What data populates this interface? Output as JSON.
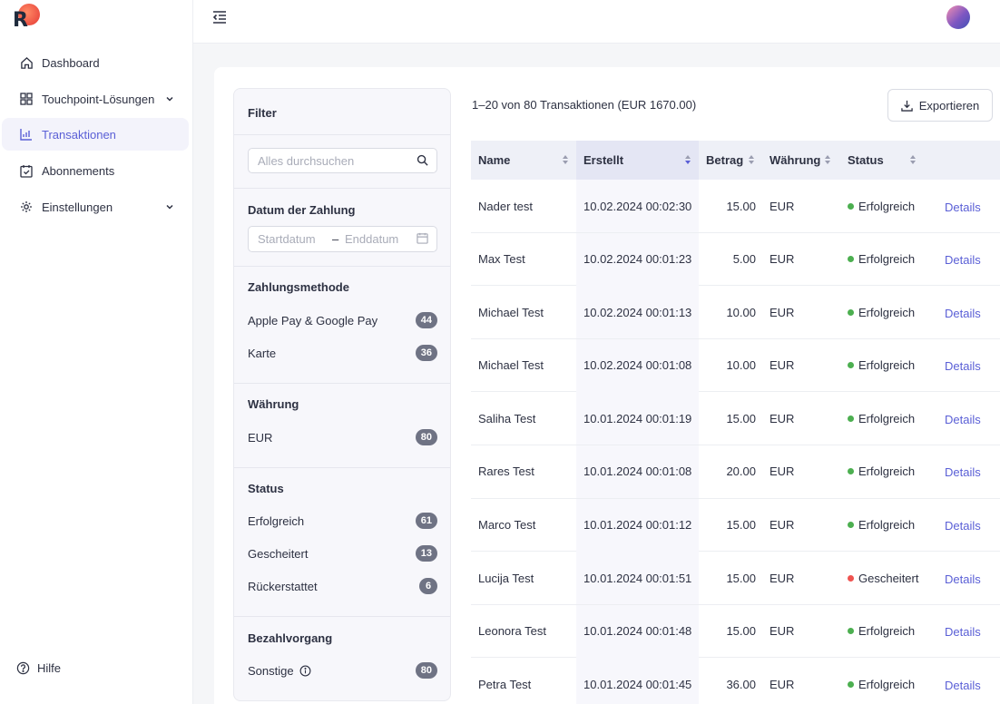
{
  "sidebar": {
    "logo_letter": "R",
    "items": [
      {
        "label": "Dashboard",
        "icon": "home-icon"
      },
      {
        "label": "Touchpoint-Lösungen",
        "icon": "grid-icon"
      },
      {
        "label": "Transaktionen",
        "icon": "bar-chart-icon"
      },
      {
        "label": "Abonnements",
        "icon": "calendar-check-icon"
      },
      {
        "label": "Einstellungen",
        "icon": "gear-icon"
      }
    ],
    "help_label": "Hilfe"
  },
  "filter": {
    "title": "Filter",
    "search_placeholder": "Alles durchsuchen",
    "date_heading": "Datum der Zahlung",
    "date_start_placeholder": "Startdatum",
    "date_separator": "–",
    "date_end_placeholder": "Enddatum",
    "payment_heading": "Zahlungsmethode",
    "payment_options": [
      {
        "label": "Apple Pay & Google Pay",
        "count": "44"
      },
      {
        "label": "Karte",
        "count": "36"
      }
    ],
    "currency_heading": "Währung",
    "currency_options": [
      {
        "label": "EUR",
        "count": "80"
      }
    ],
    "status_heading": "Status",
    "status_options": [
      {
        "label": "Erfolgreich",
        "count": "61"
      },
      {
        "label": "Gescheitert",
        "count": "13"
      },
      {
        "label": "Rückerstattet",
        "count": "6"
      }
    ],
    "checkout_heading": "Bezahlvorgang",
    "checkout_options": [
      {
        "label": "Sonstige",
        "count": "80"
      }
    ]
  },
  "summary": "1–20 von 80 Transaktionen (EUR 1670.00)",
  "export_label": "Exportieren",
  "table": {
    "columns": {
      "name": "Name",
      "created": "Erstellt",
      "amount": "Betrag",
      "currency": "Währung",
      "status": "Status"
    },
    "sorted_column": "Erstellt",
    "sort_direction": "desc",
    "rows": [
      {
        "name": "Nader test",
        "created": "10.02.2024 00:02:30",
        "amount": "15.00",
        "currency": "EUR",
        "status": "Erfolgreich",
        "status_color": "#4caf50",
        "action": "Details"
      },
      {
        "name": "Max Test",
        "created": "10.02.2024 00:01:23",
        "amount": "5.00",
        "currency": "EUR",
        "status": "Erfolgreich",
        "status_color": "#4caf50",
        "action": "Details"
      },
      {
        "name": "Michael Test",
        "created": "10.02.2024 00:01:13",
        "amount": "10.00",
        "currency": "EUR",
        "status": "Erfolgreich",
        "status_color": "#4caf50",
        "action": "Details"
      },
      {
        "name": "Michael Test",
        "created": "10.02.2024 00:01:08",
        "amount": "10.00",
        "currency": "EUR",
        "status": "Erfolgreich",
        "status_color": "#4caf50",
        "action": "Details"
      },
      {
        "name": "Saliha Test",
        "created": "10.01.2024 00:01:19",
        "amount": "15.00",
        "currency": "EUR",
        "status": "Erfolgreich",
        "status_color": "#4caf50",
        "action": "Details"
      },
      {
        "name": "Rares Test",
        "created": "10.01.2024 00:01:08",
        "amount": "20.00",
        "currency": "EUR",
        "status": "Erfolgreich",
        "status_color": "#4caf50",
        "action": "Details"
      },
      {
        "name": "Marco Test",
        "created": "10.01.2024 00:01:12",
        "amount": "15.00",
        "currency": "EUR",
        "status": "Erfolgreich",
        "status_color": "#4caf50",
        "action": "Details"
      },
      {
        "name": "Lucija Test",
        "created": "10.01.2024 00:01:51",
        "amount": "15.00",
        "currency": "EUR",
        "status": "Gescheitert",
        "status_color": "#ef5350",
        "action": "Details"
      },
      {
        "name": "Leonora Test",
        "created": "10.01.2024 00:01:48",
        "amount": "15.00",
        "currency": "EUR",
        "status": "Erfolgreich",
        "status_color": "#4caf50",
        "action": "Details"
      },
      {
        "name": "Petra Test",
        "created": "10.01.2024 00:01:45",
        "amount": "36.00",
        "currency": "EUR",
        "status": "Erfolgreich",
        "status_color": "#4caf50",
        "action": "Details"
      }
    ]
  },
  "colors": {
    "accent": "#5a5fd6",
    "success": "#4caf50",
    "failed": "#ef5350"
  }
}
